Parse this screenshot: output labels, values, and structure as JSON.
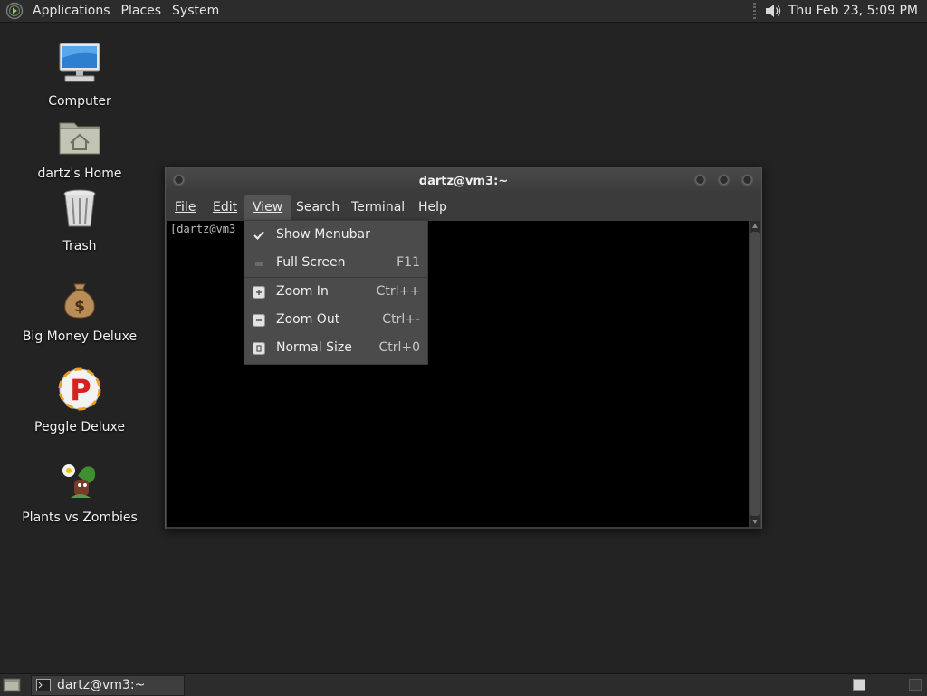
{
  "top_panel": {
    "menus": [
      "Applications",
      "Places",
      "System"
    ],
    "clock": "Thu Feb 23,  5:09 PM"
  },
  "desktop_icons": [
    {
      "label": "Computer",
      "icon": "computer-icon"
    },
    {
      "label": "dartz's Home",
      "icon": "home-folder-icon"
    },
    {
      "label": "Trash",
      "icon": "trash-icon"
    },
    {
      "label": "Big Money Deluxe",
      "icon": "money-bag-icon"
    },
    {
      "label": "Peggle Deluxe",
      "icon": "peggle-icon"
    },
    {
      "label": "Plants vs Zombies",
      "icon": "plants-vs-zombies-icon"
    }
  ],
  "window": {
    "title": "dartz@vm3:~",
    "menubar": [
      "File",
      "Edit",
      "View",
      "Search",
      "Terminal",
      "Help"
    ],
    "active_menu": "View",
    "terminal_text": "[dartz@vm3"
  },
  "view_menu": {
    "items": [
      {
        "label": "Show Menubar",
        "shortcut": "",
        "icon": "checkmark-icon",
        "checked": true
      },
      {
        "label": "Full Screen",
        "shortcut": "F11",
        "icon": "fullscreen-icon"
      },
      {
        "label": "Zoom In",
        "shortcut": "Ctrl++",
        "icon": "zoom-in-icon"
      },
      {
        "label": "Zoom Out",
        "shortcut": "Ctrl+-",
        "icon": "zoom-out-icon"
      },
      {
        "label": "Normal Size",
        "shortcut": "Ctrl+0",
        "icon": "zoom-reset-icon"
      }
    ]
  },
  "bottom_panel": {
    "task_label": "dartz@vm3:~"
  }
}
